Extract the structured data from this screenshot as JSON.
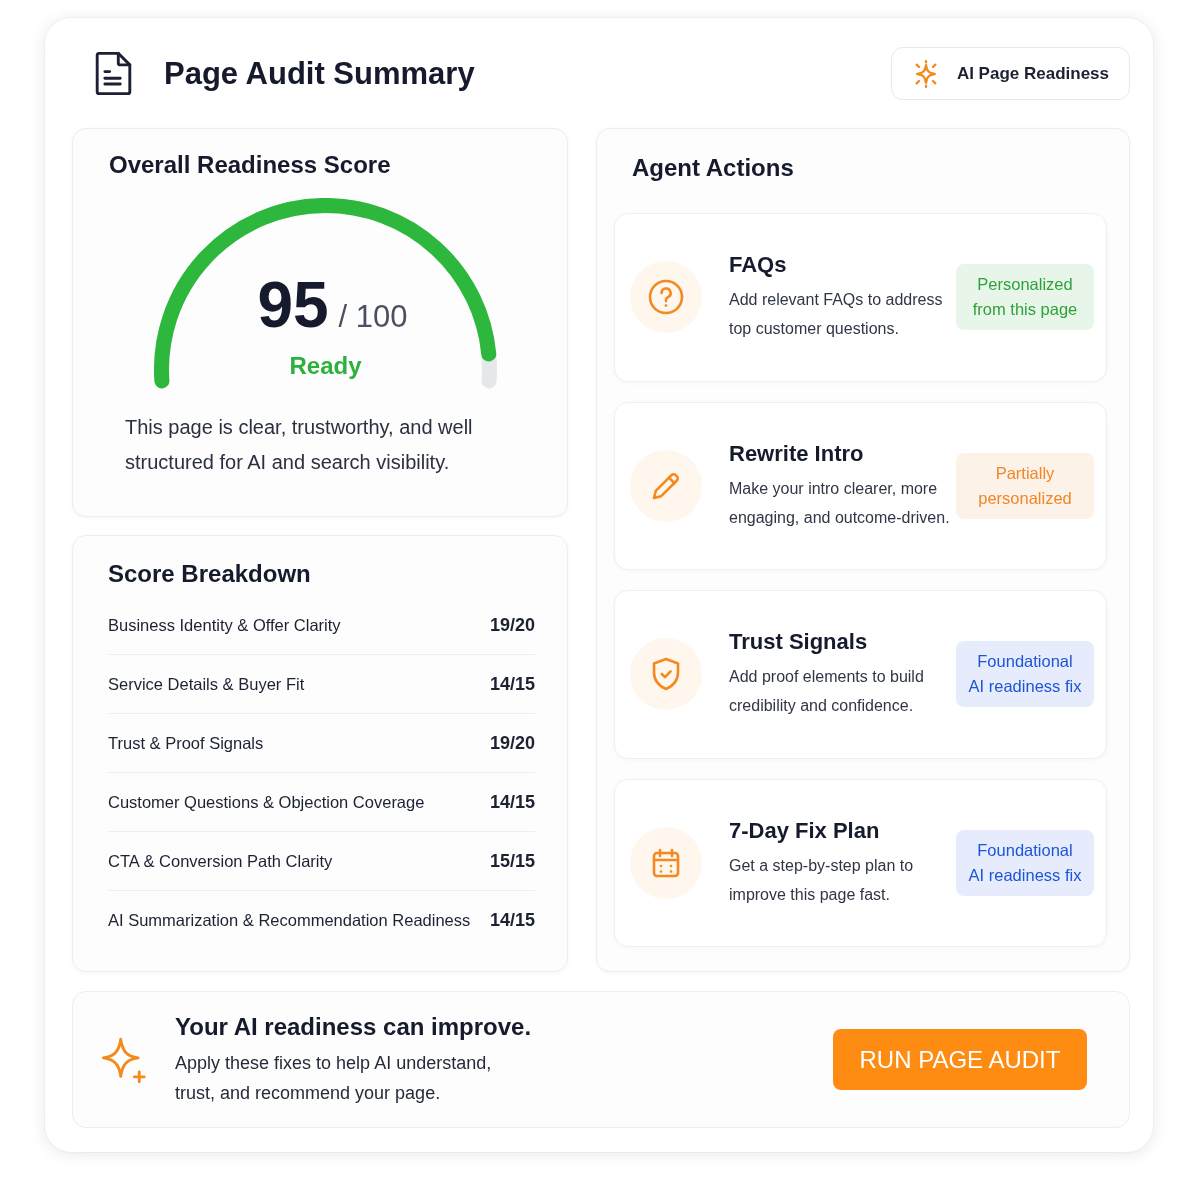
{
  "header": {
    "title": "Page Audit Summary",
    "chip": {
      "label": "AI Page Readiness"
    }
  },
  "readiness": {
    "title": "Overall Readiness Score",
    "score": "95",
    "max": "/ 100",
    "level": 0.95,
    "status": "Ready",
    "summary": "This page is clear, trustworthy, and well structured for AI and search visibility."
  },
  "breakdown": {
    "title": "Score Breakdown",
    "rows": [
      {
        "label": "Business Identity & Offer Clarity",
        "score": "19/20"
      },
      {
        "label": "Service Details & Buyer Fit",
        "score": "14/15"
      },
      {
        "label": "Trust & Proof Signals",
        "score": "19/20"
      },
      {
        "label": "Customer Questions & Objection Coverage",
        "score": "14/15"
      },
      {
        "label": "CTA & Conversion Path Clarity",
        "score": "15/15"
      },
      {
        "label": "AI Summarization & Recommendation Readiness",
        "score": "14/15"
      }
    ]
  },
  "actions": {
    "title": "Agent Actions",
    "items": [
      {
        "title": "FAQs",
        "description": "Add relevant FAQs to address top customer questions.",
        "tag": {
          "text": "Personalized from this page",
          "color": "#2ea23a"
        }
      },
      {
        "title": "Rewrite Intro",
        "description": "Make your intro clearer, more engaging, and outcome-driven.",
        "tag": {
          "text": "Partially personalized",
          "color": "#f0862a"
        }
      },
      {
        "title": "Trust Signals",
        "description": "Add proof elements to build credibility and confidence.",
        "tag": {
          "text": "Foundational AI readiness fix",
          "color": "#1c55d8"
        }
      },
      {
        "title": "7-Day Fix Plan",
        "description": "Get a step-by-step plan to improve this page fast.",
        "tag": {
          "text": "Foundational AI readiness fix",
          "color": "#1c55d8"
        }
      }
    ]
  },
  "banner": {
    "title": "Your AI readiness can improve.",
    "text": "Apply these fixes to help AI understand, trust, and recommend your page.",
    "button": "RUN PAGE AUDIT"
  }
}
